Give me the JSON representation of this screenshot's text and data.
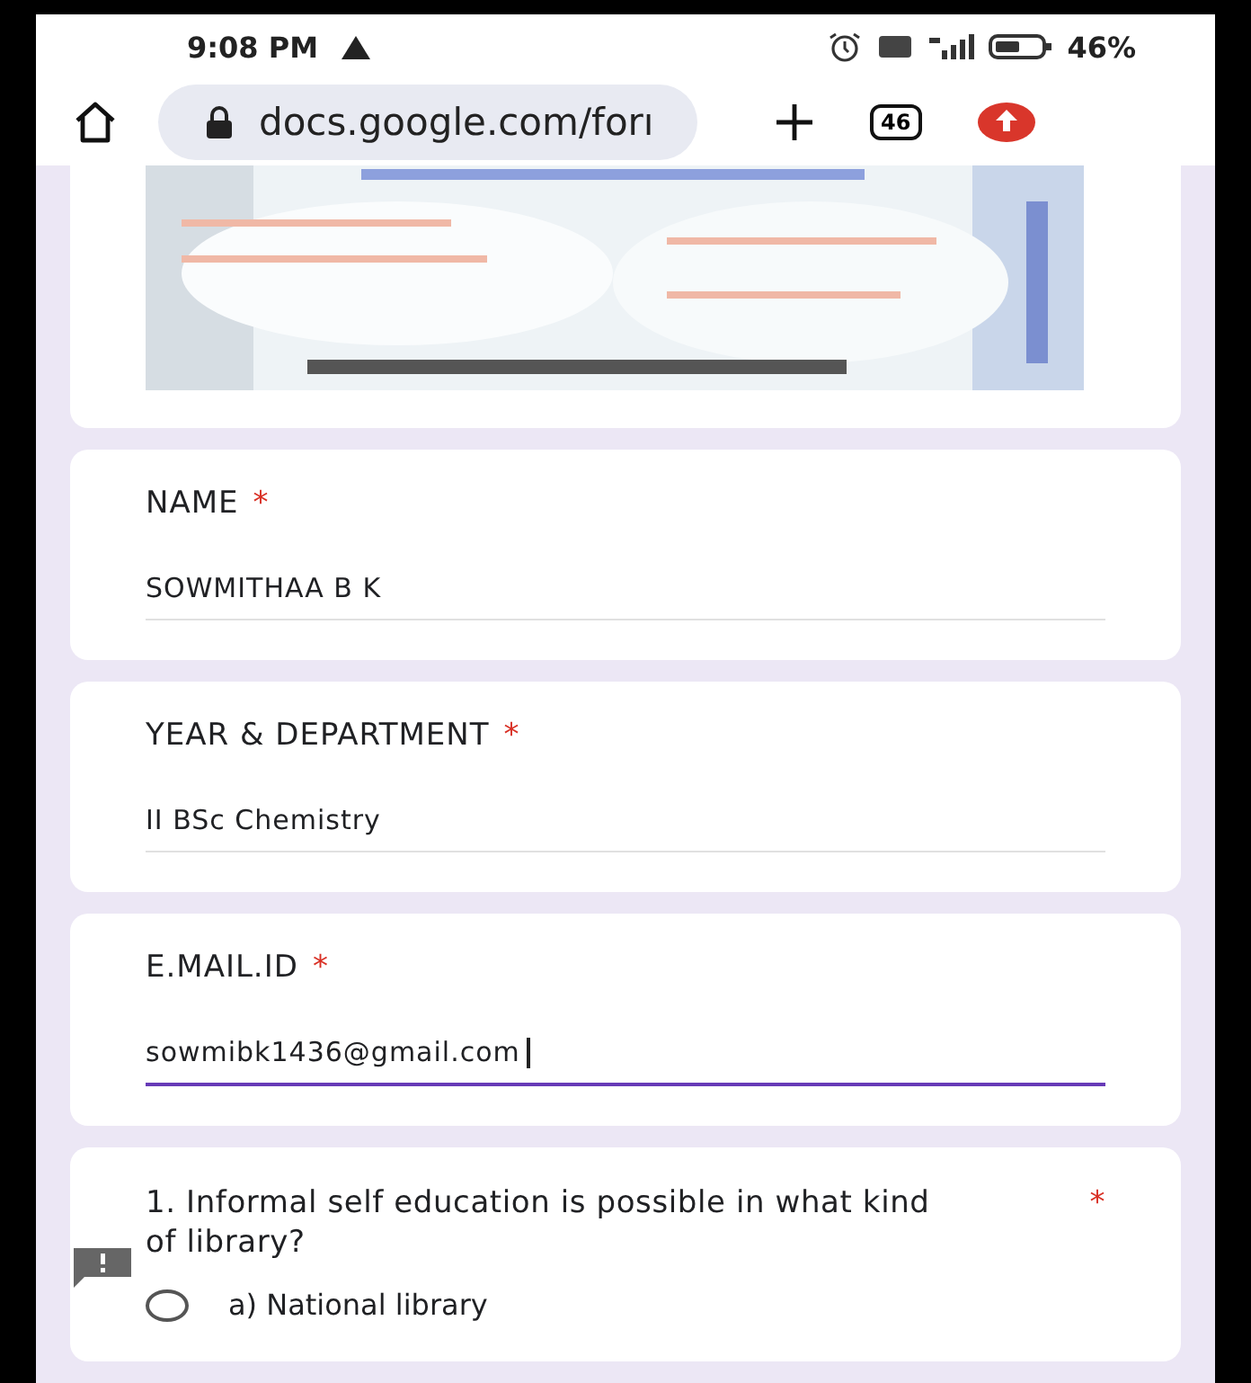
{
  "status_bar": {
    "time": "9:08 PM",
    "battery": "46%"
  },
  "browser": {
    "url": "docs.google.com/forı",
    "tab_count": "46"
  },
  "fields": [
    {
      "label": "NAME",
      "required_mark": "*",
      "value": "SOWMITHAA B K",
      "focused": false
    },
    {
      "label": "YEAR & DEPARTMENT",
      "required_mark": "*",
      "value": "II BSc Chemistry",
      "focused": false
    },
    {
      "label": "E.MAIL.ID",
      "required_mark": "*",
      "value": "sowmibk1436@gmail.com",
      "focused": true
    }
  ],
  "question": {
    "title": "1. Informal self education is possible in what kind of library?",
    "required_mark": "*",
    "options": [
      {
        "label": "a) National library",
        "selected": false
      }
    ]
  }
}
